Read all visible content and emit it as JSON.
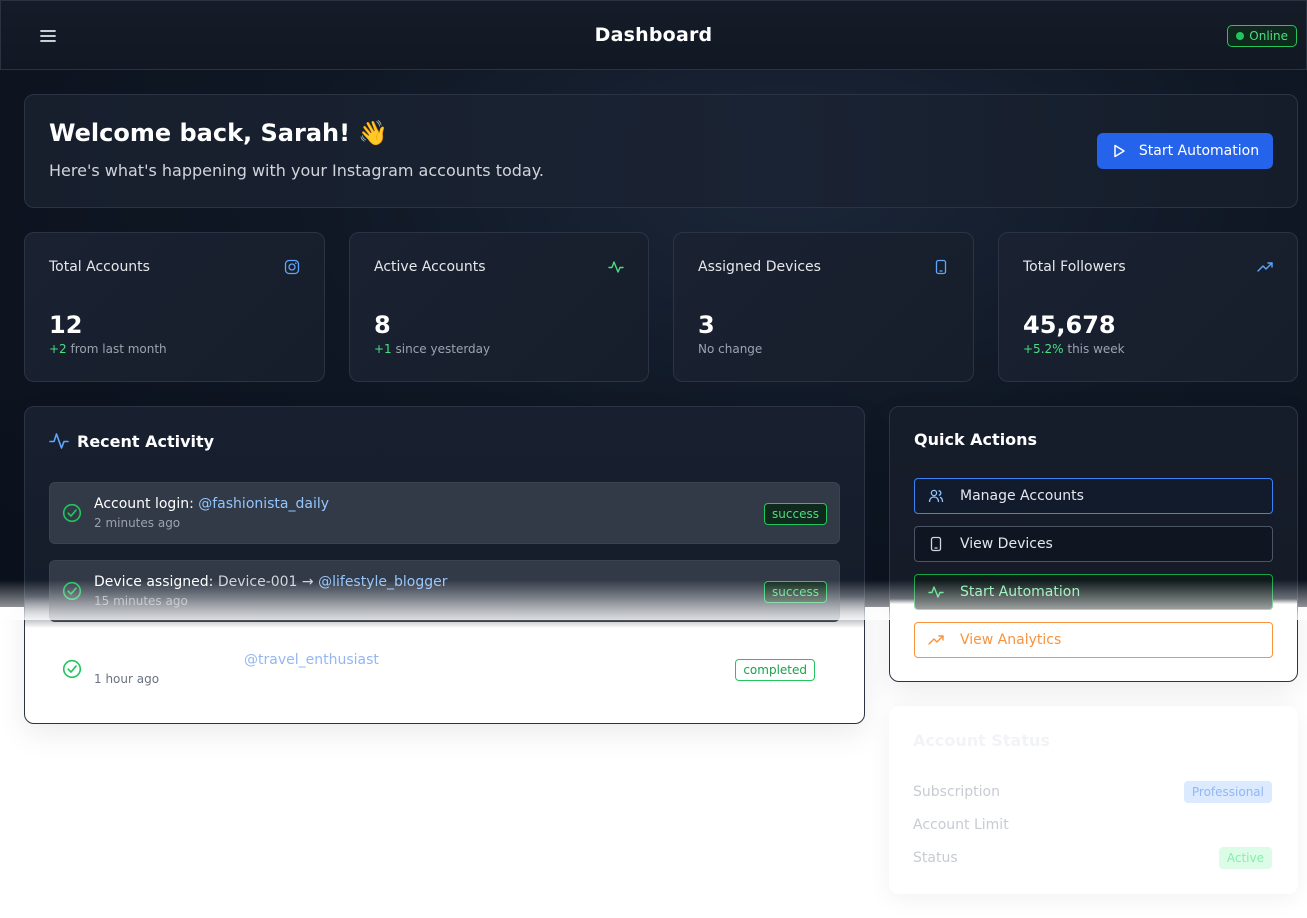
{
  "header": {
    "title": "Dashboard",
    "status": "Online"
  },
  "welcome": {
    "title": "Welcome back, Sarah! 👋",
    "subtitle": "Here's what's happening with your Instagram accounts today.",
    "cta_label": "Start Automation"
  },
  "stats": [
    {
      "title": "Total Accounts",
      "value": "12",
      "delta": "+2",
      "note": " from last month",
      "icon": "instagram-icon",
      "icon_color": "#60a5fa"
    },
    {
      "title": "Active Accounts",
      "value": "8",
      "delta": "+1",
      "note": " since yesterday",
      "icon": "activity-icon",
      "icon_color": "#4ade80"
    },
    {
      "title": "Assigned Devices",
      "value": "3",
      "delta": "",
      "note": "No change",
      "icon": "smartphone-icon",
      "icon_color": "#60a5fa"
    },
    {
      "title": "Total Followers",
      "value": "45,678",
      "delta": "+5.2%",
      "note": " this week",
      "icon": "trending-up-icon",
      "icon_color": "#60a5fa"
    }
  ],
  "recent_activity": {
    "title": "Recent Activity",
    "items": [
      {
        "action": "Account login: ",
        "detail": "",
        "handle": "@fashionista_daily",
        "time": "2 minutes ago",
        "status": "success"
      },
      {
        "action": "Device assigned: ",
        "detail": "Device-001 → ",
        "handle": "@lifestyle_blogger",
        "time": "15 minutes ago",
        "status": "success"
      },
      {
        "action": "",
        "detail": "",
        "handle": "@travel_enthusiast",
        "time": "1 hour ago",
        "status": "completed"
      }
    ]
  },
  "quick_actions": {
    "title": "Quick Actions",
    "items": [
      {
        "label": "Manage Accounts",
        "icon": "users-icon"
      },
      {
        "label": "View Devices",
        "icon": "smartphone-icon"
      },
      {
        "label": "Start Automation",
        "icon": "activity-icon"
      },
      {
        "label": "View Analytics",
        "icon": "trending-up-icon"
      }
    ]
  },
  "account_status": {
    "title": "Account Status",
    "rows": [
      {
        "label": "Subscription",
        "value": "Professional"
      },
      {
        "label": "Account Limit",
        "value": ""
      },
      {
        "label": "Status",
        "value": "Active"
      }
    ]
  },
  "colors": {
    "accent": "#2563eb",
    "success": "#22c55e",
    "warning": "#fb923c"
  }
}
